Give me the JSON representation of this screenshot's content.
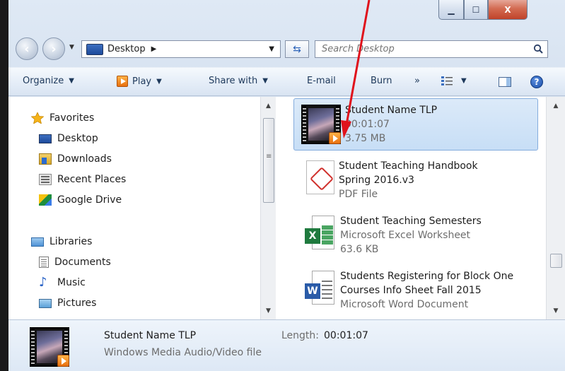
{
  "window": {
    "caption": {
      "min": "▁",
      "max": "☐",
      "close": "X"
    }
  },
  "address": {
    "location": "Desktop",
    "separator": "▶",
    "search_placeholder": "Search Desktop"
  },
  "toolbar": {
    "organize": "Organize",
    "play": "Play",
    "share": "Share with",
    "email": "E-mail",
    "burn": "Burn",
    "more": "»",
    "help": "?"
  },
  "nav": {
    "favorites_header": "Favorites",
    "favorites": [
      {
        "label": "Desktop"
      },
      {
        "label": "Downloads"
      },
      {
        "label": "Recent Places"
      },
      {
        "label": "Google Drive"
      }
    ],
    "libraries_header": "Libraries",
    "libraries": [
      {
        "label": "Documents"
      },
      {
        "label": "Music"
      },
      {
        "label": "Pictures"
      }
    ]
  },
  "files": [
    {
      "line1": "Student Name TLP",
      "line2": "00:01:07",
      "line3": "3.75 MB",
      "icon": "video-icon",
      "selected": true
    },
    {
      "line1": "Student Teaching Handbook",
      "line2": "Spring 2016.v3",
      "line3": "PDF File",
      "icon": "pdf-icon"
    },
    {
      "line1": "Student Teaching Semesters",
      "line2": "Microsoft Excel Worksheet",
      "line3": "63.6 KB",
      "icon": "excel-icon"
    },
    {
      "line1": "Students Registering for Block One",
      "line2": "Courses Info Sheet Fall 2015",
      "line3": "Microsoft Word Document",
      "icon": "word-icon"
    }
  ],
  "details": {
    "name": "Student Name TLP",
    "type": "Windows Media Audio/Video file",
    "length_label": "Length:",
    "length_value": "00:01:07"
  },
  "colors": {
    "annotation_arrow": "#e0121c",
    "selection": "#c7def6",
    "accent": "#1e395b"
  }
}
